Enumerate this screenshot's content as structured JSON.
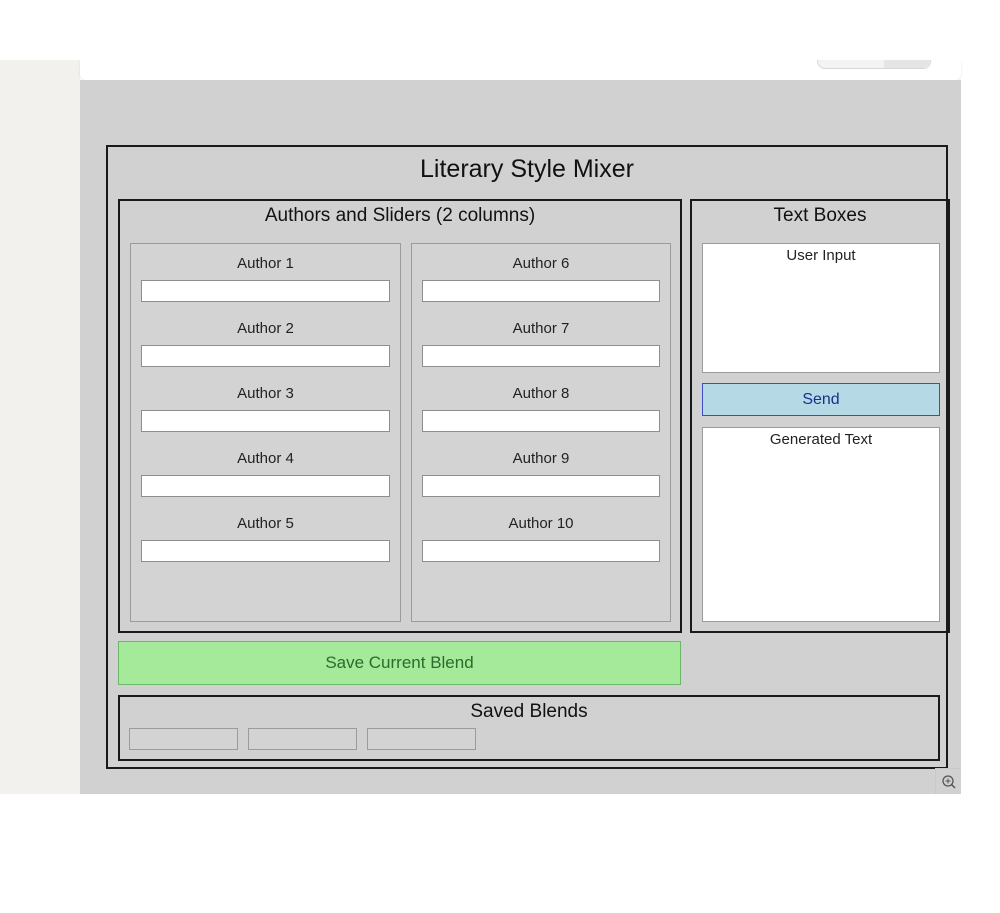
{
  "app": {
    "title": "Literary Style Mixer"
  },
  "authors_panel": {
    "title": "Authors and Sliders (2 columns)",
    "column_1": [
      "Author 1",
      "Author 2",
      "Author 3",
      "Author 4",
      "Author 5"
    ],
    "column_2": [
      "Author 6",
      "Author 7",
      "Author 8",
      "Author 9",
      "Author 10"
    ],
    "input_values": [
      "",
      "",
      "",
      "",
      "",
      "",
      "",
      "",
      "",
      ""
    ]
  },
  "text_panel": {
    "title": "Text Boxes",
    "user_input_label": "User Input",
    "send_label": "Send",
    "generated_label": "Generated Text"
  },
  "save": {
    "label": "Save Current Blend"
  },
  "saved_blends": {
    "title": "Saved Blends",
    "slots": [
      "",
      "",
      ""
    ]
  },
  "colors": {
    "canvas_bg": "#d0d1d0",
    "send_bg": "#b6d9e6",
    "send_border": "#3a4ec9",
    "save_bg": "#a5e99a",
    "save_text": "#2c6b2a"
  },
  "icons": {
    "zoom": "zoom-in-icon"
  }
}
